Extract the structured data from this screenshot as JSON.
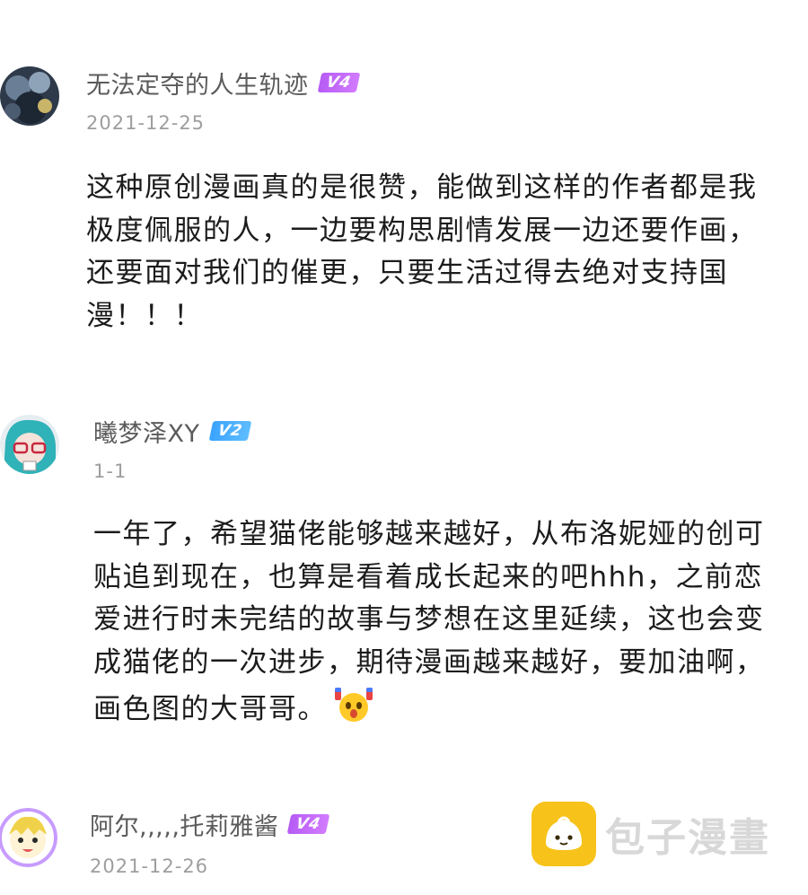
{
  "comments": [
    {
      "username": "无法定夺的人生轨迹",
      "level": "V4",
      "date": "2021-12-25",
      "lines": [
        "这种原创漫画真的是很赞，能做到这样的作者都是我",
        "极度佩服的人，一边要构思剧情发展一边还要作画，",
        "还要面对我们的催更，只要生活过得去绝对支持国",
        "漫！！！"
      ]
    },
    {
      "username": "曦梦泽XY",
      "level": "V2",
      "date": "1-1",
      "lines": [
        "一年了，希望猫佬能够越来越好，从布洛妮娅的创可",
        "贴追到现在，也算是看着成长起来的吧hhh，之前恋",
        "爱进行时未完结的故事与梦想在这里延续，这也会变",
        "成猫佬的一次进步，期待漫画越来越好，要加油啊，",
        "画色图的大哥哥。"
      ],
      "emoji": "cheering-emoji"
    },
    {
      "username": "阿尔,,,,,托莉雅酱",
      "level": "V4",
      "date": "2021-12-26"
    }
  ],
  "watermark": {
    "text": "包子漫畫",
    "logo": "bun-logo-icon"
  },
  "colors": {
    "badge_v4": "#b65bf5",
    "badge_v2": "#3aa3ff",
    "username": "#5b5b5b",
    "date": "#9e9e9e",
    "watermark_logo": "#f7c21a"
  }
}
